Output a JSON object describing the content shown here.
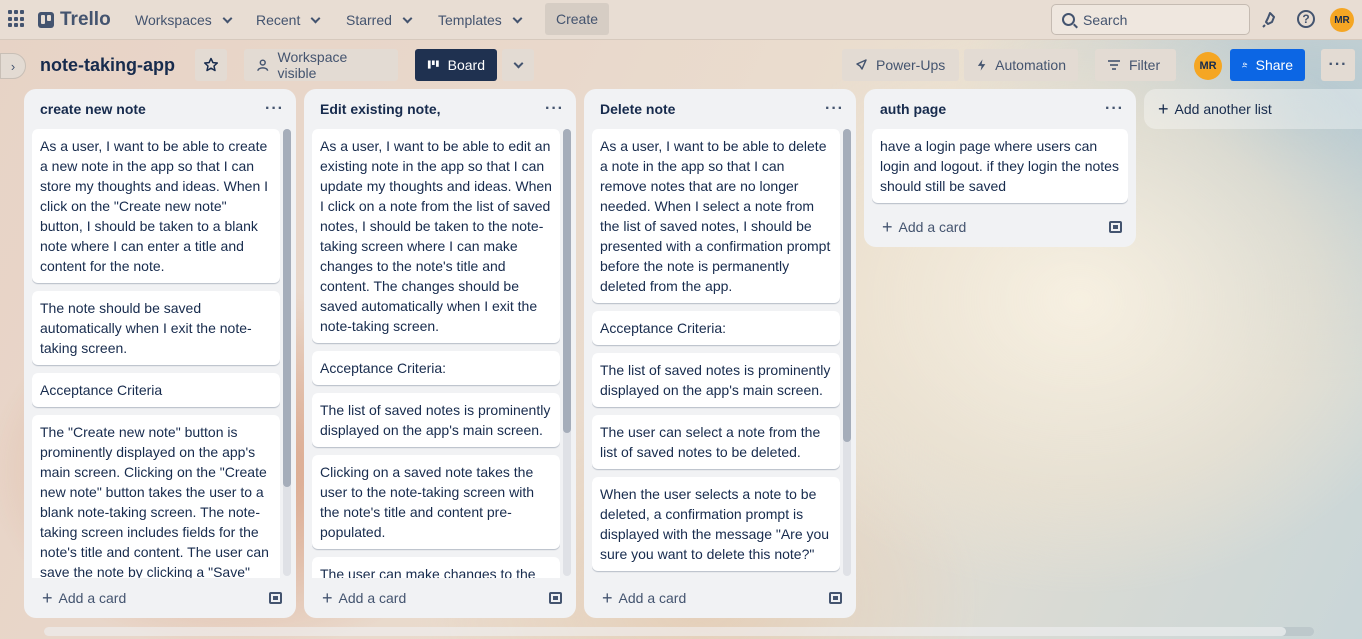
{
  "nav": {
    "logo": "Trello",
    "menus": [
      "Workspaces",
      "Recent",
      "Starred",
      "Templates"
    ],
    "create": "Create",
    "search_placeholder": "Search",
    "avatar_initials": "MR"
  },
  "board": {
    "title": "note-taking-app",
    "visibility": "Workspace visible",
    "view": "Board",
    "powerups": "Power-Ups",
    "automation": "Automation",
    "filter": "Filter",
    "member_initials": "MR",
    "share": "Share"
  },
  "lists": [
    {
      "title": "create new note",
      "scroll_fraction": 0.8,
      "cards": [
        "As a user, I want to be able to create a new note in the app so that I can store my thoughts and ideas. When I click on the \"Create new note\" button, I should be taken to a blank note where I can enter a title and content for the note.",
        "The note should be saved automatically when I exit the note-taking screen.",
        "Acceptance Criteria",
        "The \"Create new note\" button is prominently displayed on the app's main screen. Clicking on the \"Create new note\" button takes the user to a blank note-taking screen. The note-taking screen includes fields for the note's title and content. The user can save the note by clicking a \"Save\""
      ]
    },
    {
      "title": "Edit existing note,",
      "scroll_fraction": 0.68,
      "cards": [
        "As a user, I want to be able to edit an existing note in the app so that I can update my thoughts and ideas. When I click on a note from the list of saved notes, I should be taken to the note-taking screen where I can make changes to the note's title and content. The changes should be saved automatically when I exit the note-taking screen.",
        "Acceptance Criteria:",
        "The list of saved notes is prominently displayed on the app's main screen.",
        "Clicking on a saved note takes the user to the note-taking screen with the note's title and content pre-populated.",
        "The user can make changes to the"
      ]
    },
    {
      "title": "Delete note",
      "scroll_fraction": 0.7,
      "cards": [
        "As a user, I want to be able to delete a note in the app so that I can remove notes that are no longer needed. When I select a note from the list of saved notes, I should be presented with a confirmation prompt before the note is permanently deleted from the app.",
        "Acceptance Criteria:",
        "The list of saved notes is prominently displayed on the app's main screen.",
        "The user can select a note from the list of saved notes to be deleted.",
        "When the user selects a note to be deleted, a confirmation prompt is displayed with the message \"Are you sure you want to delete this note?\"",
        ""
      ]
    },
    {
      "title": "auth page",
      "scroll_fraction": 0,
      "cards": [
        "have a login page where users can login and logout. if they login the notes should still be saved"
      ]
    }
  ],
  "add_card_label": "Add a card",
  "add_list_label": "Add another list"
}
